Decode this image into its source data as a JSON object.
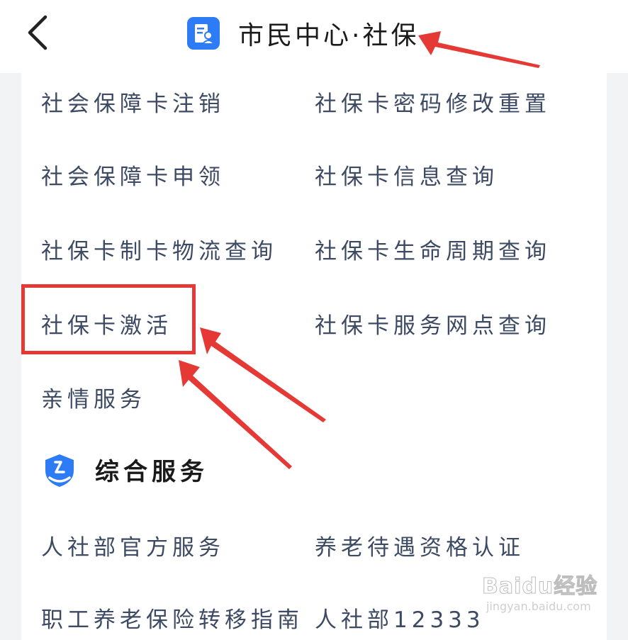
{
  "header": {
    "title": "市民中心·社保"
  },
  "icons": {
    "back": "chevron-left-icon",
    "title": "id-card-icon",
    "section": "person-shield-icon"
  },
  "colors": {
    "accent": "#2d7cf6",
    "text": "#3d4a63",
    "annotation": "#e53935"
  },
  "social_security_card": {
    "items": [
      "社会保障卡注销",
      "社保卡密码修改重置",
      "社会保障卡申领",
      "社保卡信息查询",
      "社保卡制卡物流查询",
      "社保卡生命周期查询",
      "社保卡激活",
      "社保卡服务网点查询",
      "亲情服务"
    ]
  },
  "comprehensive": {
    "title": "综合服务",
    "items": [
      "人社部官方服务",
      "养老待遇资格认证",
      "职工养老保险转移指南",
      "人社部12333"
    ]
  },
  "watermark": {
    "brand": "Baidu经验",
    "url": "jingyan.baidu.com"
  }
}
